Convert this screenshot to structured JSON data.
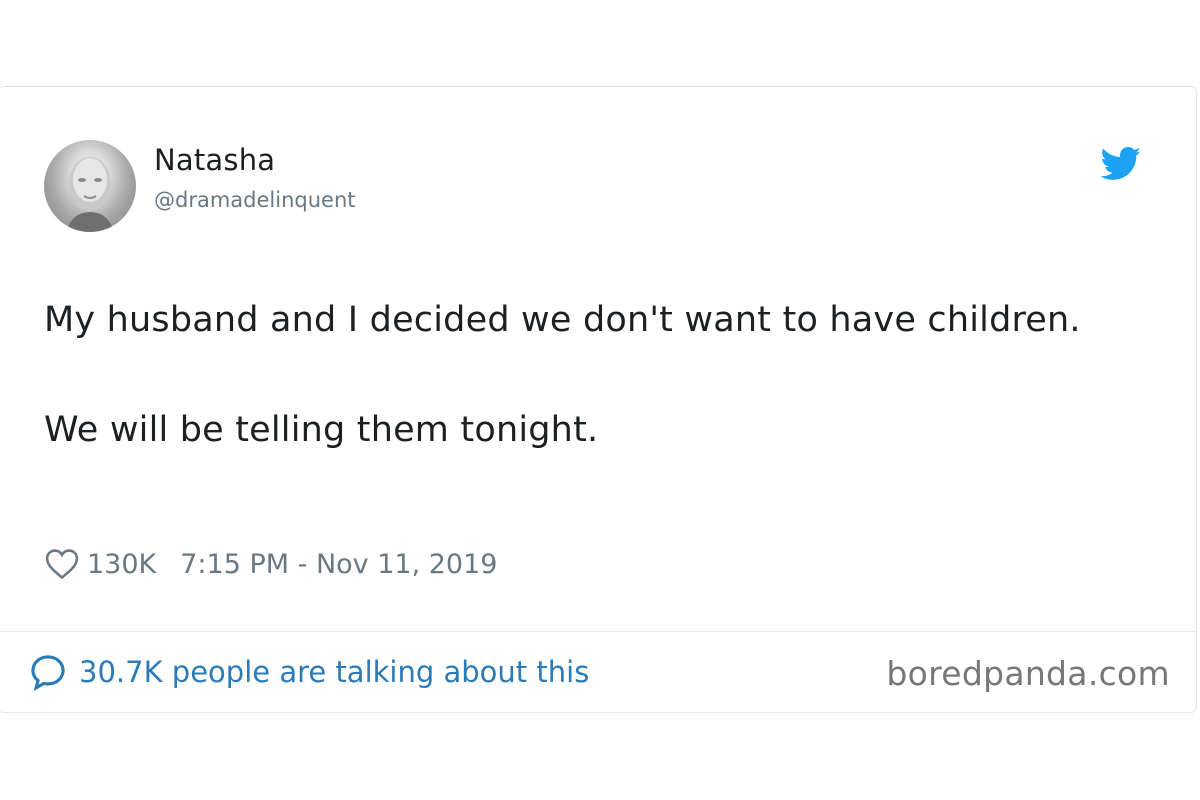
{
  "author": {
    "name": "Natasha",
    "handle": "@dramadelinquent"
  },
  "tweet": {
    "paragraphs": [
      "My husband and I decided we don't want to have children.",
      "We will be telling them tonight."
    ]
  },
  "meta": {
    "likes": "130K",
    "timestamp": "7:15 PM - Nov 11, 2019"
  },
  "footer": {
    "conversation": "30.7K people are talking about this",
    "watermark": "boredpanda.com"
  },
  "icons": {
    "brand": "twitter-bird-icon",
    "like": "heart-icon",
    "conversation": "speech-bubble-icon"
  },
  "colors": {
    "brand_blue": "#1da1f2",
    "link_blue": "#2b7bb9",
    "text": "#1c2022",
    "muted": "#697882",
    "border": "#e1e8ed"
  }
}
